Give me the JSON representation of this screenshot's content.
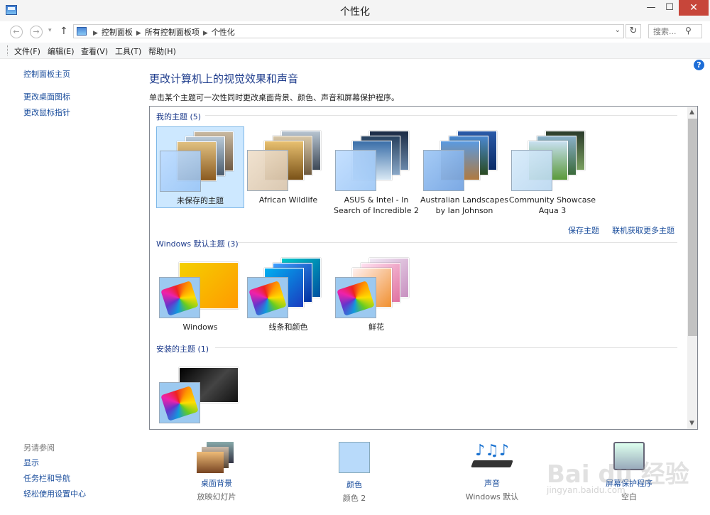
{
  "window": {
    "title": "个性化",
    "minimize": "—",
    "maximize": "☐",
    "close": "✕"
  },
  "nav": {
    "back": "←",
    "forward": "→",
    "dropdown": "▾",
    "up": "↑",
    "refresh": "↻",
    "address_dropdown": "⌄"
  },
  "breadcrumb": [
    "控制面板",
    "所有控制面板项",
    "个性化"
  ],
  "search": {
    "placeholder": "搜索...",
    "icon": "search-icon"
  },
  "menu": [
    "文件(F)",
    "编辑(E)",
    "查看(V)",
    "工具(T)",
    "帮助(H)"
  ],
  "sidebar": {
    "home": "控制面板主页",
    "links": [
      "更改桌面图标",
      "更改鼠标指针"
    ],
    "see_also_title": "另请参阅",
    "see_also": [
      "显示",
      "任务栏和导航",
      "轻松使用设置中心"
    ]
  },
  "help": "?",
  "heading": "更改计算机上的视觉效果和声音",
  "subheading": "单击某个主题可一次性同时更改桌面背景、颜色、声音和屏幕保护程序。",
  "groups": {
    "my": {
      "title": "我的主题 (5)",
      "themes": [
        "未保存的主题",
        "African Wildlife",
        "ASUS & Intel - In Search of Incredible 2",
        "Australian Landscapes by Ian Johnson",
        "Community Showcase Aqua 3"
      ],
      "save_link": "保存主题",
      "more_link": "联机获取更多主题"
    },
    "default": {
      "title": "Windows 默认主题 (3)",
      "themes": [
        "Windows",
        "线条和颜色",
        "鲜花"
      ]
    },
    "installed": {
      "title": "安装的主题 (1)",
      "themes": [
        ""
      ]
    }
  },
  "scroll": {
    "up": "▲",
    "down": "▼"
  },
  "footer": [
    {
      "label": "桌面背景",
      "value": "放映幻灯片"
    },
    {
      "label": "颜色",
      "value": "颜色 2"
    },
    {
      "label": "声音",
      "value": "Windows 默认"
    },
    {
      "label": "屏幕保护程序",
      "value": "空白"
    }
  ],
  "watermark": {
    "text": "Bai du 经验",
    "url": "jingyan.baidu.com"
  },
  "colors": {
    "link": "#1a4d9c",
    "heading": "#1e3c8c",
    "selected": "#cde8ff",
    "close": "#c7463a"
  }
}
